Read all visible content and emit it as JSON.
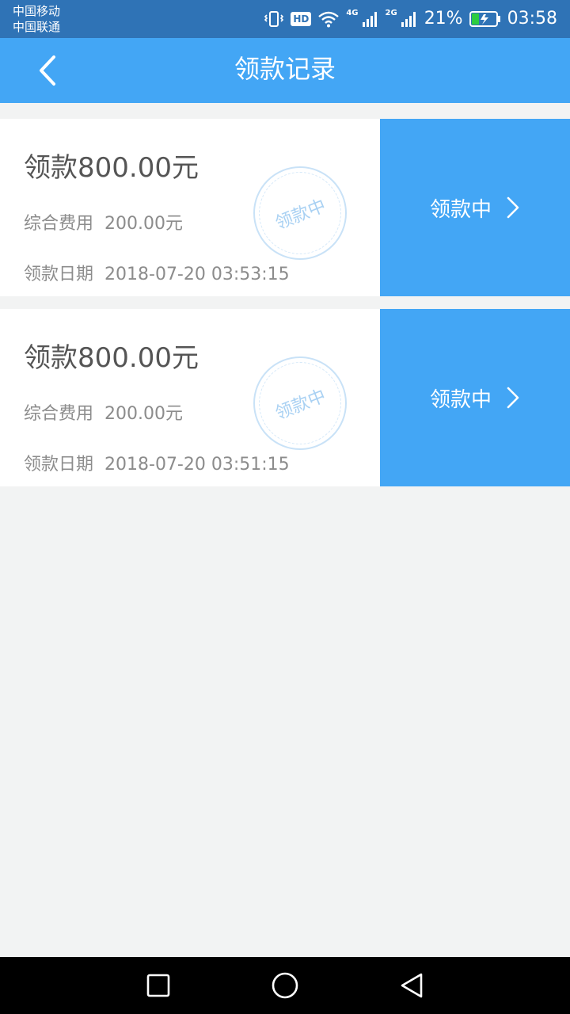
{
  "status_bar": {
    "carriers": [
      "中国移动",
      "中国联通"
    ],
    "hd_label": "HD",
    "net_4g": "4G",
    "net_2g": "2G",
    "battery": "21%",
    "time": "03:58"
  },
  "header": {
    "title": "领款记录",
    "back_icon": "chevron-left-icon"
  },
  "records": [
    {
      "amount": "领款800.00元",
      "fee_label": "综合费用",
      "fee_value": "200.00元",
      "date_label": "领款日期",
      "date_value": "2018-07-20 03:53:15",
      "stamp": "领款中",
      "action_label": "领款中"
    },
    {
      "amount": "领款800.00元",
      "fee_label": "综合费用",
      "fee_value": "200.00元",
      "date_label": "领款日期",
      "date_value": "2018-07-20 03:51:15",
      "stamp": "领款中",
      "action_label": "领款中"
    }
  ],
  "colors": {
    "status_bar": "#2f73b6",
    "accent": "#43a6f5",
    "background": "#f2f3f3",
    "battery_fill": "#2ecc40"
  },
  "nav_bar": {
    "icons": [
      "square-icon",
      "circle-icon",
      "triangle-back-icon"
    ]
  }
}
